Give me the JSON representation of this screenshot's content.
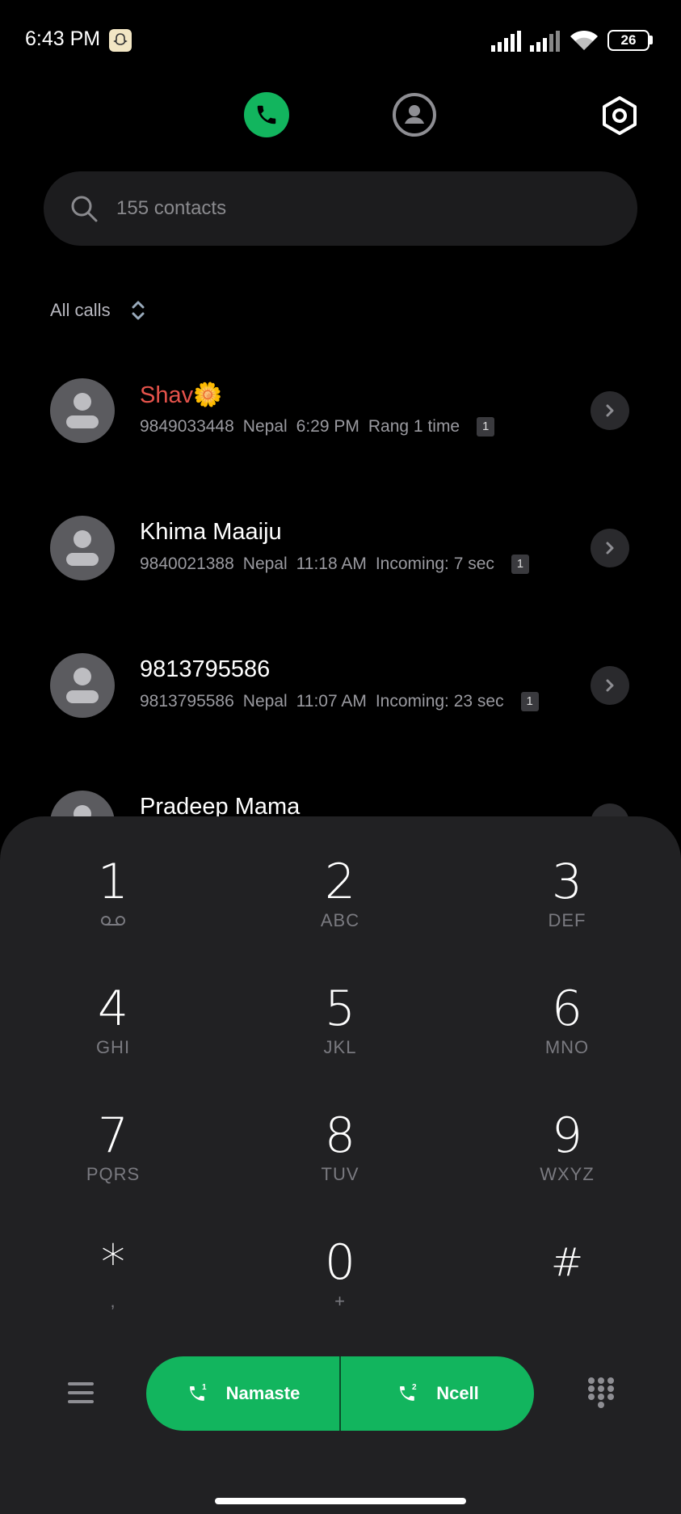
{
  "status_bar": {
    "time": "6:43 PM",
    "battery": "26"
  },
  "search": {
    "placeholder": "155 contacts"
  },
  "filter": {
    "label": "All calls"
  },
  "calls": [
    {
      "name": "Shav🌼",
      "number": "9849033448",
      "location": "Nepal",
      "time": "6:29 PM",
      "detail": "Rang 1 time",
      "sim": "1",
      "missed": true
    },
    {
      "name": "Khima Maaiju",
      "number": "9840021388",
      "location": "Nepal",
      "time": "11:18 AM",
      "detail": "Incoming: 7 sec",
      "sim": "1",
      "missed": false
    },
    {
      "name": "9813795586",
      "number": "9813795586",
      "location": "Nepal",
      "time": "11:07 AM",
      "detail": "Incoming: 23 sec",
      "sim": "1",
      "missed": false
    },
    {
      "name": "Pradeep Mama"
    }
  ],
  "dialpad": {
    "keys": [
      {
        "digit": "1",
        "sub": ""
      },
      {
        "digit": "2",
        "sub": "ABC"
      },
      {
        "digit": "3",
        "sub": "DEF"
      },
      {
        "digit": "4",
        "sub": "GHI"
      },
      {
        "digit": "5",
        "sub": "JKL"
      },
      {
        "digit": "6",
        "sub": "MNO"
      },
      {
        "digit": "7",
        "sub": "PQRS"
      },
      {
        "digit": "8",
        "sub": "TUV"
      },
      {
        "digit": "9",
        "sub": "WXYZ"
      },
      {
        "digit": "*",
        "sub": ","
      },
      {
        "digit": "0",
        "sub": "+"
      },
      {
        "digit": "#",
        "sub": ""
      }
    ]
  },
  "call_buttons": [
    {
      "sim": "1",
      "label": "Namaste"
    },
    {
      "sim": "2",
      "label": "Ncell"
    }
  ],
  "colors": {
    "accent_green": "#12b55e",
    "missed_red": "#e5534b",
    "panel": "#212123"
  },
  "icons": [
    "phone-icon",
    "contacts-icon",
    "settings-icon",
    "search-icon",
    "sort-chevron-icon",
    "chevron-right-icon",
    "voicemail-icon",
    "menu-icon",
    "keypad-icon"
  ]
}
